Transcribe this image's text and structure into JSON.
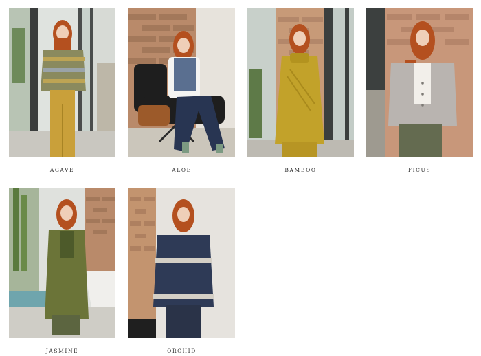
{
  "gallery": {
    "items": [
      {
        "name": "AGAVE"
      },
      {
        "name": "ALOE"
      },
      {
        "name": "BAMBOO"
      },
      {
        "name": "FICUS"
      },
      {
        "name": "JASMINE"
      },
      {
        "name": "ORCHID"
      }
    ]
  },
  "colors": {
    "hair": "#b4501f",
    "skin": "#efcfb8",
    "brick": "#b98a6a",
    "agave_knit": "#8a8a5e",
    "agave_trousers": "#c9a03a",
    "aloe_vest": "#5a6f90",
    "aloe_jeans": "#283552",
    "bamboo_knit": "#c2a22a",
    "ficus_cardigan": "#b9b4b0",
    "ficus_trousers": "#646b50",
    "jasmine_coat": "#6b7438",
    "orchid_sweater": "#2e3a56"
  }
}
